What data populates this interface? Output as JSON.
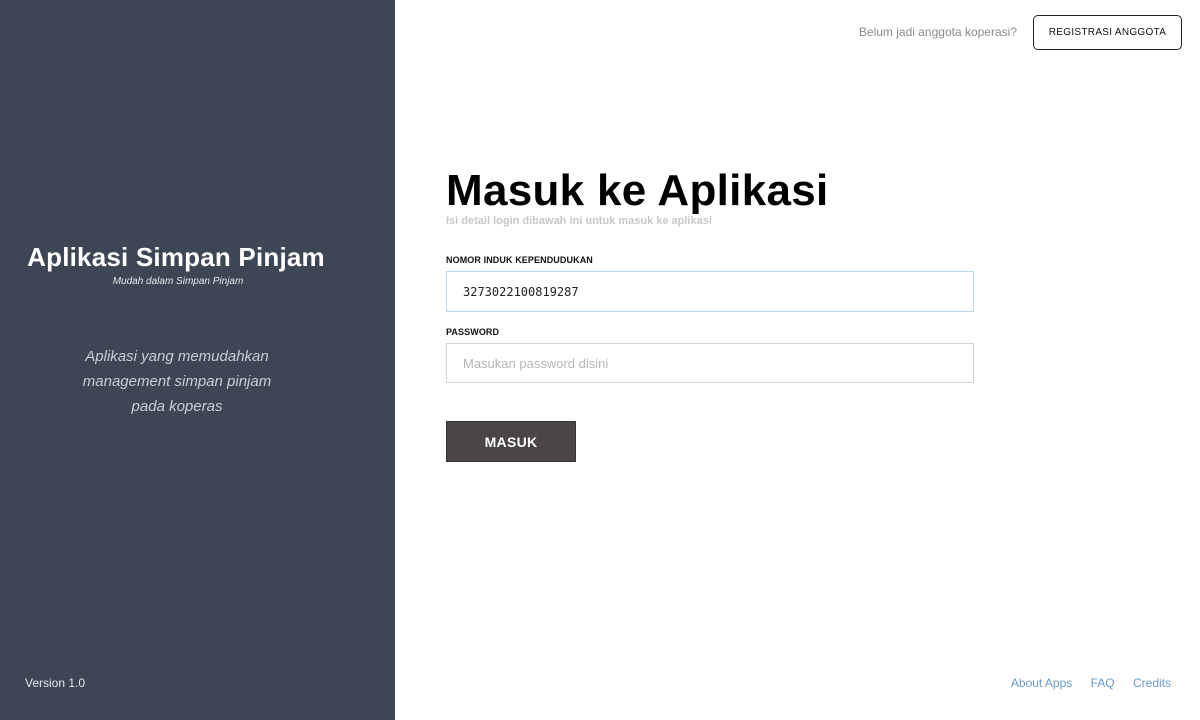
{
  "sidebar": {
    "title": "Aplikasi Simpan Pinjam",
    "subtitle": "Mudah dalam Simpan Pinjam",
    "description_lines": [
      "Aplikasi yang memudahkan",
      "management simpan pinjam",
      "pada koperas"
    ],
    "version": "Version 1.0",
    "background_color": "#3d4654"
  },
  "topbar": {
    "question": "Belum jadi anggota koperasi?",
    "register_label": "REGISTRASI ANGGOTA"
  },
  "login": {
    "heading": "Masuk ke Aplikasi",
    "subheading": "Isi detail login dibawah ini untuk masuk ke aplikasi",
    "nik_label": "NOMOR INDUK KEPENDUDUKAN",
    "nik_value": "3273022100819287",
    "password_label": "PASSWORD",
    "password_placeholder": "Masukan password disini",
    "submit_label": "MASUK",
    "button_color": "#4b4646"
  },
  "footer": {
    "links": [
      "About Apps",
      "FAQ",
      "Credits"
    ],
    "link_color": "#6a99c9"
  }
}
